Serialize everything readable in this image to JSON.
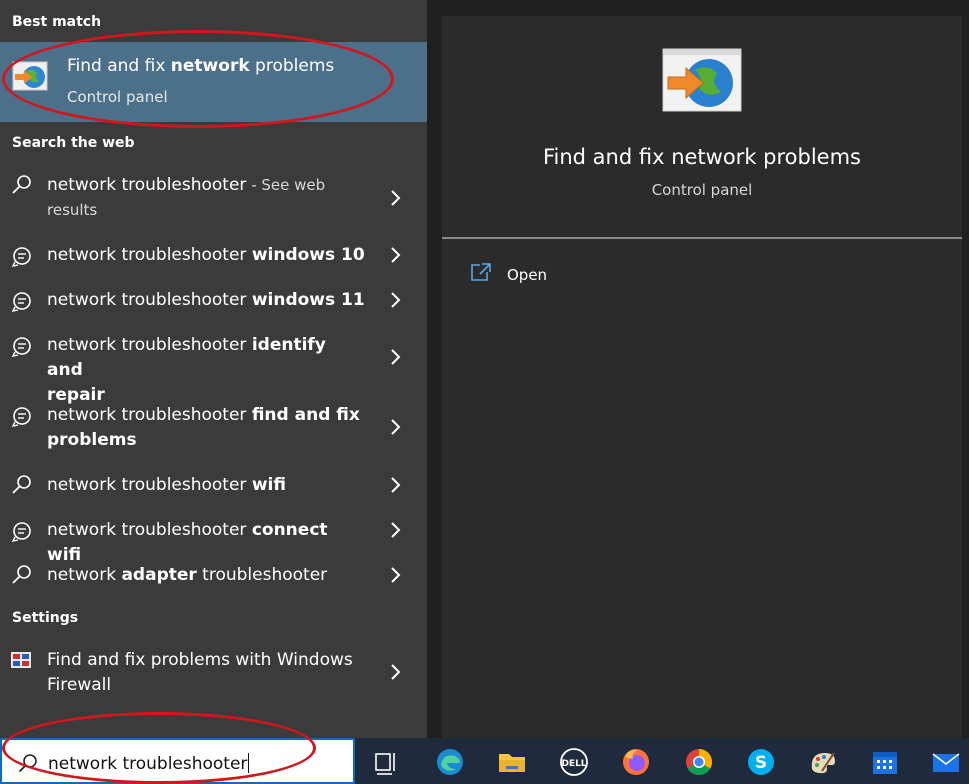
{
  "left_panel": {
    "best_match_header": "Best match",
    "best_match": {
      "title_pre": "Find and fix ",
      "title_bold": "network",
      "title_post": " problems",
      "subtitle": "Control panel",
      "icon": "network-troubleshooter-icon"
    },
    "web_header": "Search the web",
    "web_results": [
      {
        "icon": "search-icon",
        "pre": "network troubleshooter",
        "bold": "",
        "hint": " - See web",
        "line2": "results"
      },
      {
        "icon": "chat-search-icon",
        "pre": "network troubleshooter ",
        "bold": "windows 10",
        "hint": "",
        "line2": ""
      },
      {
        "icon": "chat-search-icon",
        "pre": "network troubleshooter ",
        "bold": "windows 11",
        "hint": "",
        "line2": ""
      },
      {
        "icon": "chat-search-icon",
        "pre": "network troubleshooter ",
        "bold": "identify and",
        "hint": "",
        "line2": "repair"
      },
      {
        "icon": "chat-search-icon",
        "pre": "network troubleshooter ",
        "bold": "find and fix",
        "hint": "",
        "line2": "problems"
      },
      {
        "icon": "search-icon",
        "pre": "network troubleshooter ",
        "bold": "wifi",
        "hint": "",
        "line2": ""
      },
      {
        "icon": "chat-search-icon",
        "pre": "network troubleshooter ",
        "bold": "connect wifi",
        "hint": "",
        "line2": ""
      },
      {
        "icon": "search-icon",
        "pre": "network ",
        "bold": "adapter",
        "post": " troubleshooter",
        "hint": "",
        "line2": ""
      }
    ],
    "settings_header": "Settings",
    "settings_result": {
      "line1": "Find and fix problems with Windows",
      "line2": "Firewall",
      "icon": "firewall-icon"
    }
  },
  "preview": {
    "title": "Find and fix network problems",
    "subtitle": "Control panel",
    "open_label": "Open"
  },
  "taskbar": {
    "search_value": "network troubleshooter",
    "icons": [
      "task-view-icon",
      "edge-icon",
      "file-explorer-icon",
      "dell-icon",
      "firefox-icon",
      "chrome-icon",
      "skype-icon",
      "paint-icon",
      "calendar-icon",
      "mail-icon"
    ]
  },
  "colors": {
    "highlight": "#4c6f8a",
    "panel": "#3b3b3b",
    "preview_bg": "#2b2b2b",
    "annotation_red": "#d4151c",
    "taskbar": "#1f2b3c"
  }
}
